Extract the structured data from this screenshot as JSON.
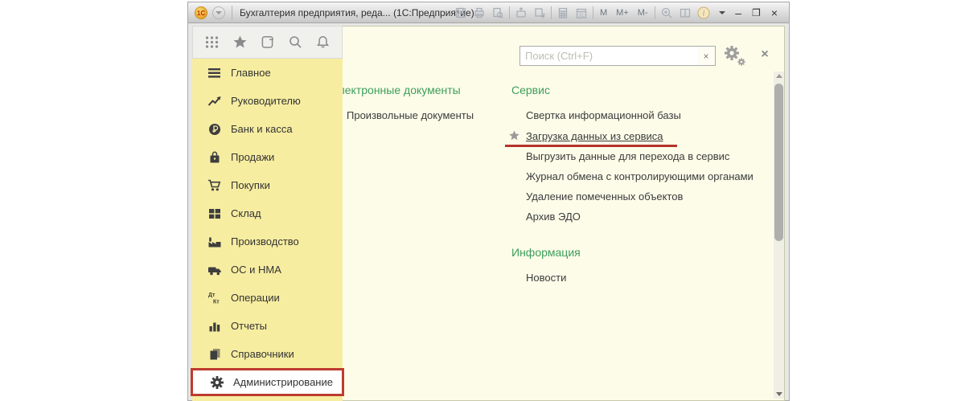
{
  "titlebar": {
    "logo_text": "1С",
    "title": "Бухгалтерия предприятия, реда...  (1С:Предприятие)",
    "m": "M",
    "m_plus": "M+",
    "m_minus": "M-",
    "info_glyph": "i",
    "minimize": "–",
    "maximize": "❐",
    "close": "×"
  },
  "sidebar": {
    "items": [
      {
        "label": "Главное"
      },
      {
        "label": "Руководителю"
      },
      {
        "label": "Банк и касса"
      },
      {
        "label": "Продажи"
      },
      {
        "label": "Покупки"
      },
      {
        "label": "Склад"
      },
      {
        "label": "Производство"
      },
      {
        "label": "ОС и НМА"
      },
      {
        "label": "Операции"
      },
      {
        "label": "Отчеты"
      },
      {
        "label": "Справочники"
      },
      {
        "label": "Администрирование",
        "highlighted": true
      }
    ]
  },
  "panel": {
    "search_placeholder": "Поиск (Ctrl+F)",
    "search_clear": "×",
    "close": "×",
    "col_documents": {
      "header": "Электронные документы",
      "items": [
        "Произвольные документы"
      ]
    },
    "col_service": {
      "header": "Сервис",
      "items": [
        "Свертка информационной базы",
        "Загрузка данных из сервиса",
        "Выгрузить данные для перехода в сервис",
        "Журнал обмена с контролирующими органами",
        "Удаление помеченных объектов",
        "Архив ЭДО"
      ],
      "starred_item_index": 1
    },
    "col_info": {
      "header": "Информация",
      "items": [
        "Новости"
      ]
    }
  },
  "colors": {
    "sidebar_yellow": "#F7EDA1",
    "panel_cream": "#FCFCE9",
    "header_green": "#3E9E5A",
    "annotation_red": "#BE3B2F",
    "titlebar_gray": "#DCDCDC"
  }
}
